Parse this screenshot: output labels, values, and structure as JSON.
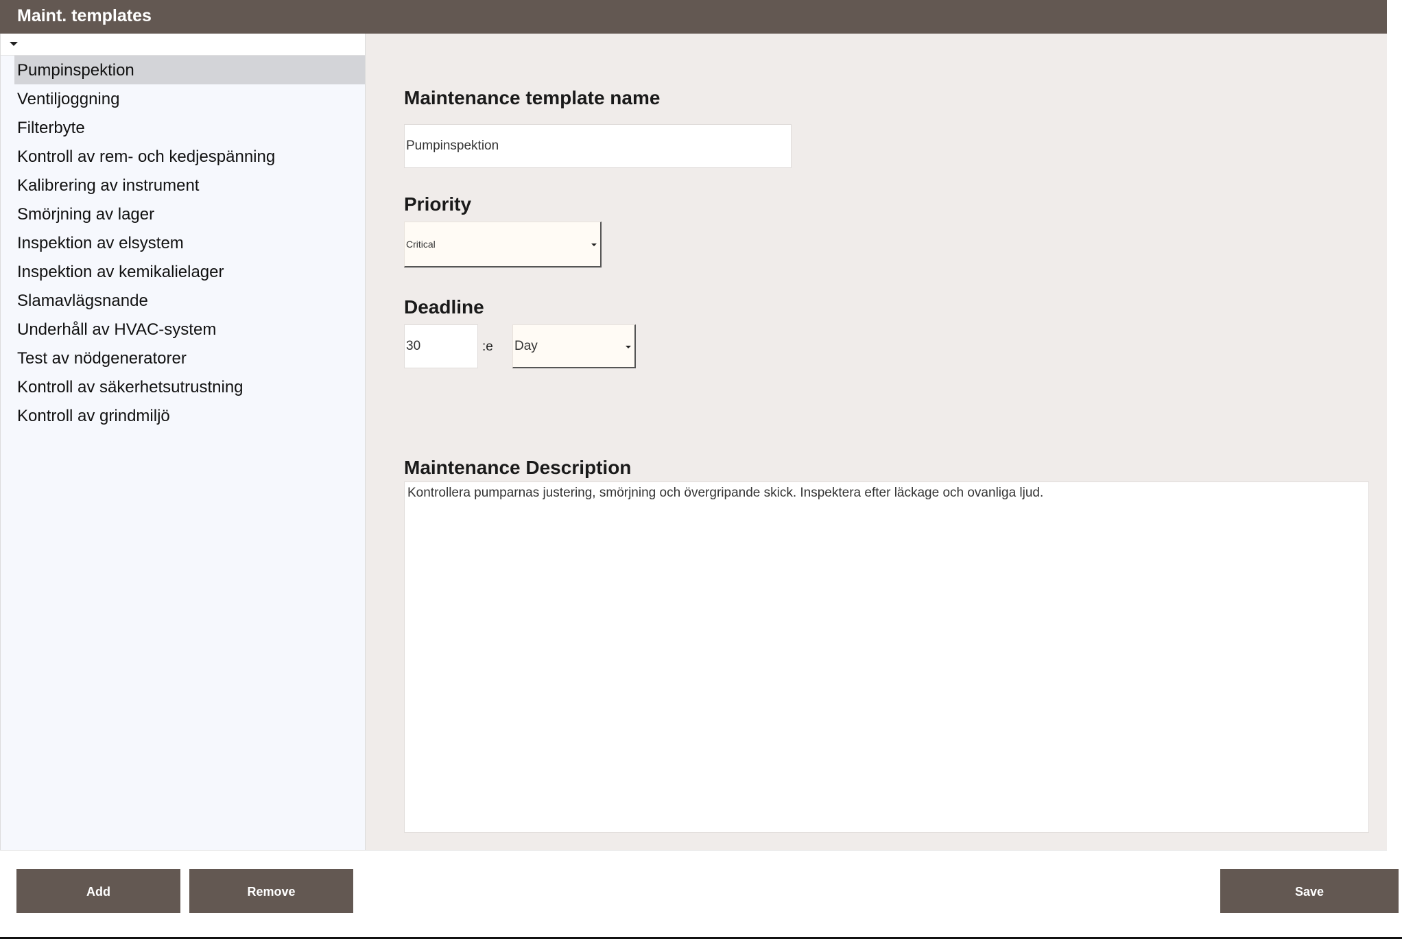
{
  "header": {
    "title": "Maint. templates"
  },
  "sidebar": {
    "sort_icon": "caret-down-icon",
    "selected_index": 0,
    "items": [
      "Pumpinspektion",
      "Ventiljoggning",
      "Filterbyte",
      "Kontroll av rem- och kedjespänning",
      "Kalibrering av instrument",
      "Smörjning av lager",
      "Inspektion av elsystem",
      "Inspektion av kemikalielager",
      "Slamavlägsnande",
      "Underhåll av HVAC-system",
      "Test av nödgeneratorer",
      "Kontroll av säkerhetsutrustning",
      "Kontroll av grindmiljö"
    ]
  },
  "form": {
    "name_label": "Maintenance template name",
    "name_value": "Pumpinspektion",
    "priority_label": "Priority",
    "priority_value": "Critical",
    "deadline_label": "Deadline",
    "deadline_number": "30",
    "deadline_suffix": ":e",
    "deadline_unit": "Day",
    "description_label": "Maintenance Description",
    "description_value": "Kontrollera pumparnas justering, smörjning och övergripande skick. Inspektera efter läckage och ovanliga ljud."
  },
  "actions": {
    "add_label": "Add",
    "remove_label": "Remove",
    "save_label": "Save"
  },
  "colors": {
    "header_bg": "#635852",
    "sidebar_bg": "#f6f8fd",
    "selected_bg": "#d3d4d8",
    "panel_bg": "#f0ecea",
    "button_bg": "#635852"
  }
}
